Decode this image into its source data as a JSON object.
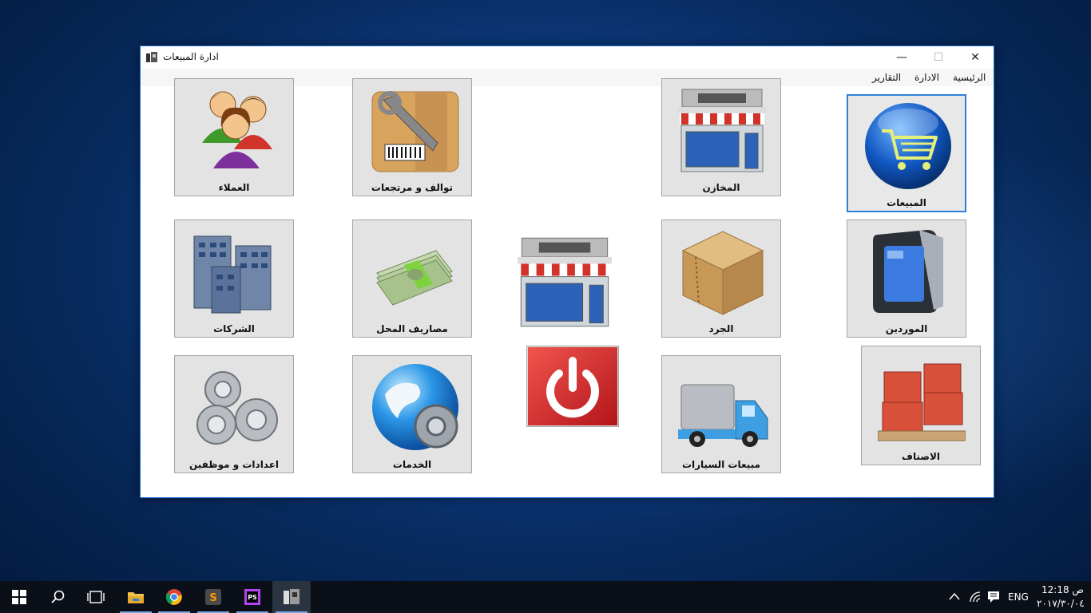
{
  "window": {
    "title": "ادارة المبيعات",
    "controls": {
      "minimize": "—",
      "maximize": "☐",
      "close": "✕"
    }
  },
  "menu": {
    "items": [
      "الرئيسية",
      "الادارة",
      "التقارير"
    ]
  },
  "tiles": {
    "sales": "المبيعات",
    "stores": "المخازن",
    "damaged_returns": "توالف و مرتجعات",
    "customers": "العملاء",
    "suppliers": "الموردين",
    "inventory": "الجرد",
    "shop_expenses": "مصاريف المحل",
    "companies": "الشركات",
    "items": "الاصناف",
    "car_sales": "مبيعات السيارات",
    "services": "الخدمات",
    "settings_employees": "اعدادات و موظفين"
  },
  "taskbar": {
    "apps": [
      "start",
      "search",
      "task-view",
      "file-explorer",
      "chrome",
      "sublime-text",
      "phpstorm",
      "sales-app"
    ],
    "language": "ENG",
    "time": "12:18 ص",
    "date": "٢٠١٧/٣٠/٠٤"
  },
  "colors": {
    "accent": "#2f7fd9",
    "tile_bg": "#e3e3e3",
    "taskbar_bg": "#0b0f17"
  }
}
